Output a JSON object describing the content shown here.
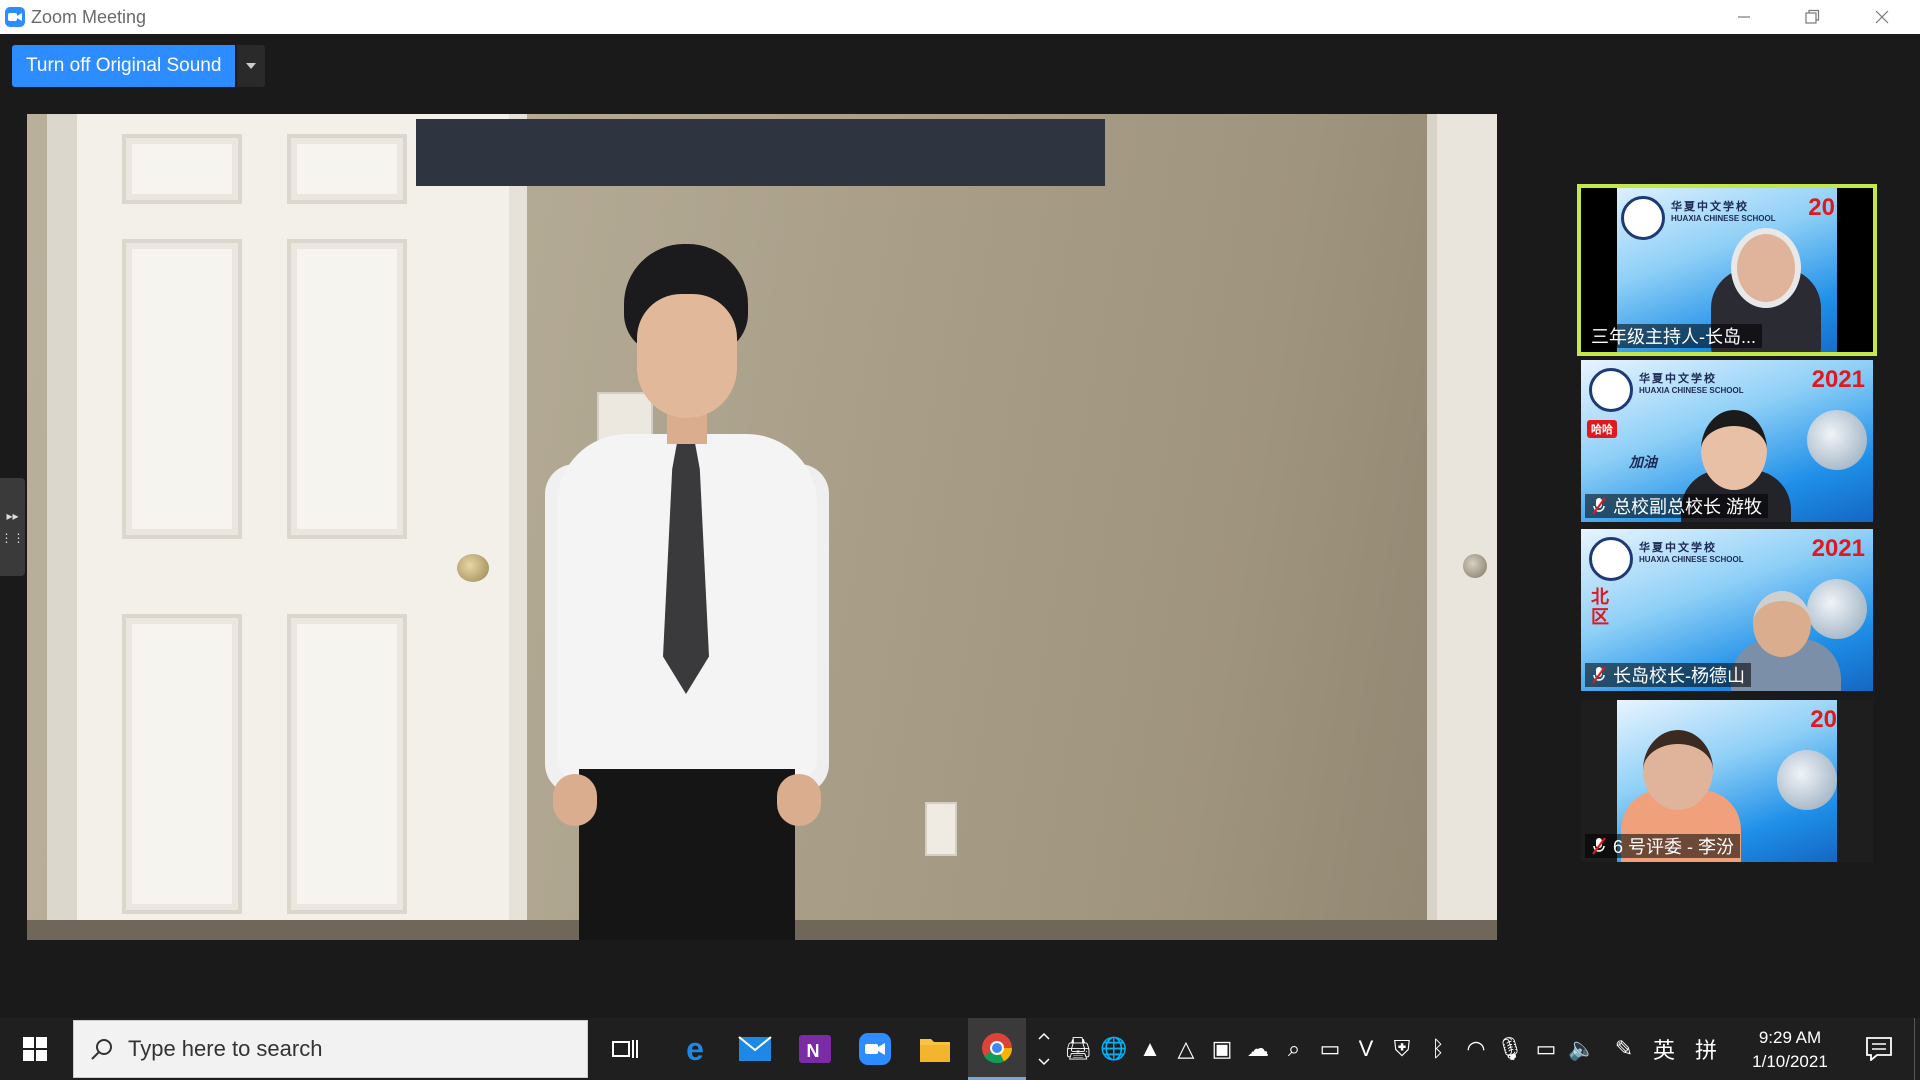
{
  "window": {
    "title": "Zoom Meeting",
    "minimize_icon": "minimize-icon",
    "restore_icon": "restore-icon",
    "close_icon": "close-icon"
  },
  "toolbar": {
    "original_sound_label": "Turn off Original Sound",
    "dropdown_icon": "caret-down-icon"
  },
  "gallery": {
    "tiles": [
      {
        "name": "三年级主持人-长岛...",
        "muted": false,
        "active": true,
        "year": "20"
      },
      {
        "name": "总校副总校长 游牧",
        "muted": true,
        "active": false,
        "year": "2021"
      },
      {
        "name": "长岛校长-杨德山",
        "muted": true,
        "active": false,
        "year": "2021"
      },
      {
        "name": "6 号评委 - 李汾",
        "muted": true,
        "active": false,
        "year": "20"
      }
    ],
    "school_cn": "华夏中文学校",
    "school_en": "HUAXIA CHINESE SCHOOL",
    "tile2_badge": "哈哈",
    "tile3_side_text": "北区",
    "tile2_side_text": "加油"
  },
  "taskbar": {
    "search_placeholder": "Type here to search",
    "time": "9:29 AM",
    "date": "1/10/2021",
    "ime_label": "英",
    "ime_mode": "拼"
  },
  "colors": {
    "accent": "#2d8cff",
    "active_speaker_border": "#c3e84a",
    "taskbar_bg": "#1f1f1f"
  }
}
